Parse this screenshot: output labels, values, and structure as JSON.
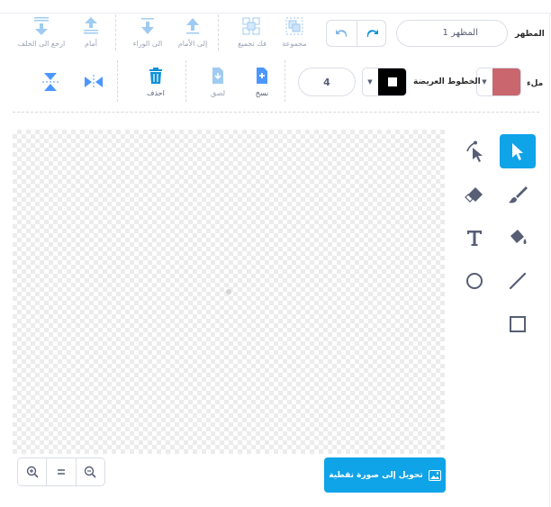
{
  "toolbar": {
    "costume_label": "المظهر",
    "costume_name": "المظهر 1",
    "group_label": "مجموعة",
    "ungroup_label": "فك تجميع",
    "forward_label": "إلى الأمام",
    "backward_label": "الى الوراء",
    "front_label": "الى الأمام",
    "back_label": "أمام",
    "to_back_label": "ارجع الى الخلف",
    "fill_label": "ملء",
    "outline_label": "الخطوط العريضة",
    "outline_size": "4",
    "copy_label": "نسخ",
    "paste_label": "لصق",
    "delete_label": "احذف"
  },
  "colors": {
    "fill": "#c9666e",
    "outline": "#000000",
    "accent": "#0fa3e8"
  },
  "canvas": {
    "convert_button_label": "تحويل إلى صورة نقطية",
    "zoom_in_icon": "zoom-in-icon",
    "zoom_reset_icon": "equals-icon",
    "zoom_out_icon": "zoom-out-icon"
  },
  "tools": [
    "select",
    "reshape",
    "brush",
    "eraser",
    "fill",
    "text",
    "line",
    "circle",
    "rectangle"
  ]
}
